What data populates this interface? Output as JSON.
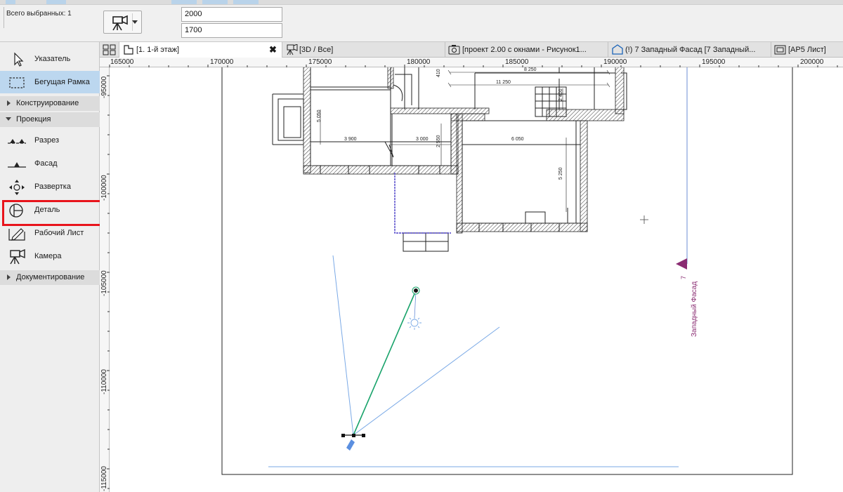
{
  "infobox": {
    "selected_label": "Всего выбранных: 1",
    "field_top": "2000",
    "field_bottom": "1700",
    "camera_icon": "camera-icon"
  },
  "toolbox": {
    "items": [
      {
        "label": "Указатель",
        "icon": "pointer-arrow-icon"
      },
      {
        "label": "Бегущая Рамка",
        "icon": "marquee-icon"
      },
      {
        "label": "Разрез",
        "icon": "section-icon"
      },
      {
        "label": "Фасад",
        "icon": "elevation-icon"
      },
      {
        "label": "Развертка",
        "icon": "interior-elevation-icon"
      },
      {
        "label": "Деталь",
        "icon": "detail-icon"
      },
      {
        "label": "Рабочий Лист",
        "icon": "worksheet-icon"
      },
      {
        "label": "Камера",
        "icon": "camera-icon"
      }
    ],
    "groups": {
      "design": "Конструирование",
      "viewpoint": "Проекция",
      "document": "Документирование"
    }
  },
  "tabs": [
    {
      "label": "[1. 1-й этаж]",
      "icon": "floor-plan-icon",
      "active": true
    },
    {
      "label": "[3D / Все]",
      "icon": "camera-icon"
    },
    {
      "label": "[проект 2.00 с окнами - Рисунок1...",
      "icon": "photo-icon"
    },
    {
      "label": "(!) 7 Западный Фасад [7 Западный...",
      "icon": "elevation-house-icon"
    },
    {
      "label": "[АР5 Лист]",
      "icon": "layout-sheet-icon"
    }
  ],
  "ruler_h": [
    "165000",
    "170000",
    "175000",
    "180000",
    "185000",
    "190000",
    "195000",
    "200000"
  ],
  "ruler_v": [
    "-95000",
    "-100000",
    "-105000",
    "-110000",
    "-115000"
  ],
  "plan": {
    "dims": [
      "8 250",
      "11 250",
      "410",
      "5 050",
      "3 900",
      "3 000",
      "2 550",
      "6 050",
      "2 400",
      "5 250"
    ],
    "elevation_marker": "7",
    "elevation_name": "Западный Фасад"
  },
  "colors": {
    "accent": "#bcd7ef",
    "highlight": "#e8141c",
    "camera_line": "#19a36b",
    "view_cone": "#7aa9e6",
    "elevation": "#8a2c72"
  }
}
